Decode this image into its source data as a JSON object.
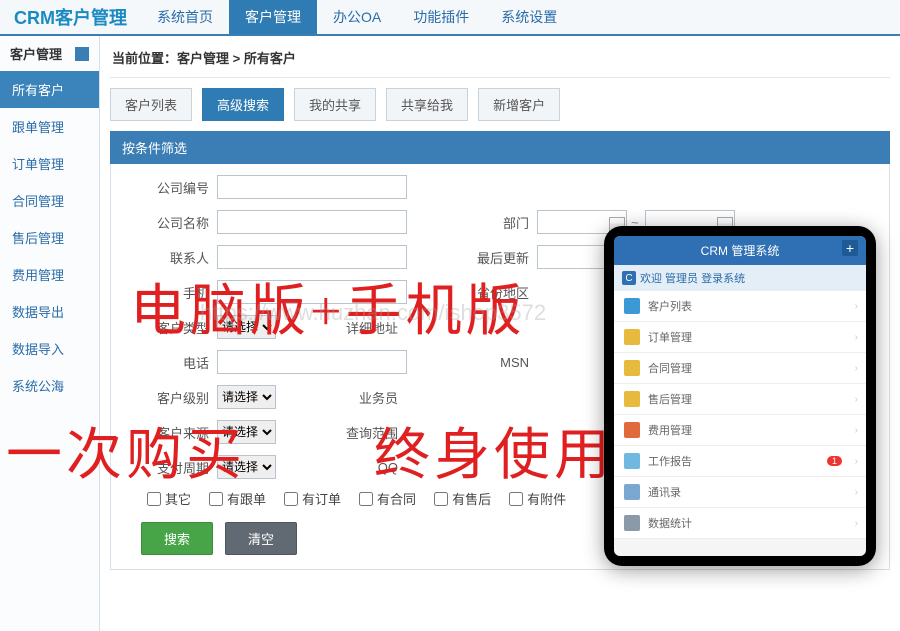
{
  "brand": "CRM客户管理",
  "topnav": [
    "系统首页",
    "客户管理",
    "办公OA",
    "功能插件",
    "系统设置"
  ],
  "topnav_active": 1,
  "sidebar_title": "客户管理",
  "sidebar": [
    "所有客户",
    "跟单管理",
    "订单管理",
    "合同管理",
    "售后管理",
    "费用管理",
    "数据导出",
    "数据导入",
    "系统公海"
  ],
  "sidebar_active": 0,
  "breadcrumb": "当前位置：客户管理 > 所有客户",
  "tabs": [
    "客户列表",
    "高级搜索",
    "我的共享",
    "共享给我",
    "新增客户"
  ],
  "tabs_active": 1,
  "panel_title": "按条件筛选",
  "labels": {
    "company_no": "公司编号",
    "company_name": "公司名称",
    "contact": "联系人",
    "mobile": "手机",
    "cust_type": "客户类型",
    "phone": "电话",
    "cust_level": "客户级别",
    "cust_source": "客户来源",
    "pay_cycle": "支付周期",
    "dept": "部门",
    "last_update": "最后更新",
    "province": "省份地区",
    "address": "详细地址",
    "msn": "MSN",
    "sales": "业务员",
    "scope": "查询范围",
    "qq": "QQ"
  },
  "select_placeholder": "请选择",
  "range_sep": "~",
  "checkboxes": [
    "其它",
    "有跟单",
    "有订单",
    "有合同",
    "有售后",
    "有附件"
  ],
  "buttons": {
    "search": "搜索",
    "clear": "清空"
  },
  "overlay": {
    "line1": "电脑版+手机版",
    "line2": "一次购买",
    "line3": "终身使用"
  },
  "watermark": "https://www.huzhan.com/ishop3572",
  "phone": {
    "title": "CRM 管理系统",
    "welcome": "欢迎 管理员 登录系统",
    "items": [
      {
        "label": "客户列表",
        "color": "#3b9ad6"
      },
      {
        "label": "订单管理",
        "color": "#e7b93c"
      },
      {
        "label": "合同管理",
        "color": "#e7b93c"
      },
      {
        "label": "售后管理",
        "color": "#e7b93c"
      },
      {
        "label": "费用管理",
        "color": "#e06a3b"
      },
      {
        "label": "工作报告",
        "color": "#6fb8e0",
        "badge": "1"
      },
      {
        "label": "通讯录",
        "color": "#7aa8d0"
      },
      {
        "label": "数据统计",
        "color": "#8a9aa8"
      }
    ]
  }
}
